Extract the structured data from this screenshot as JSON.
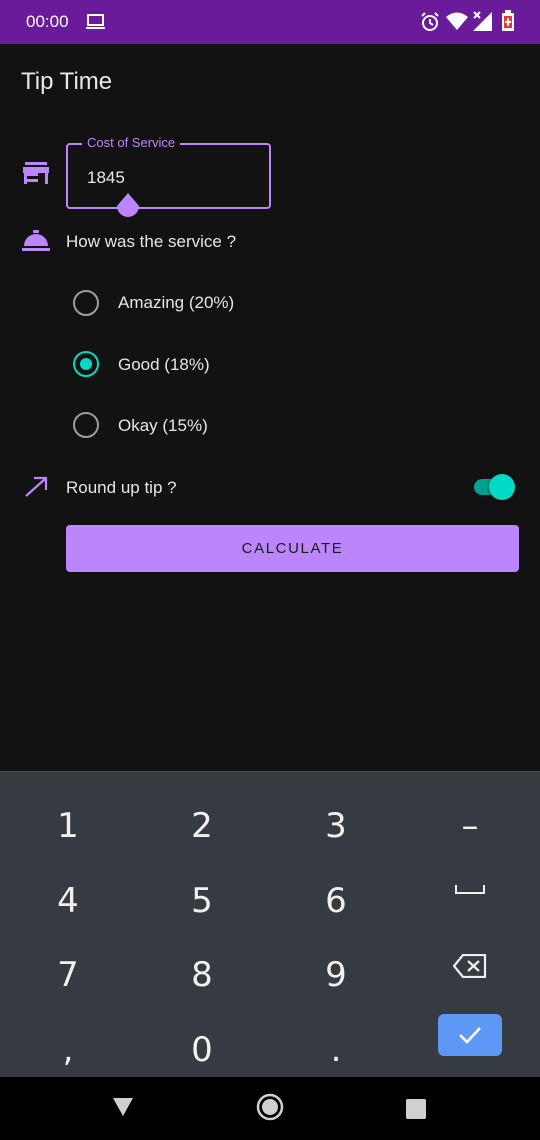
{
  "status_bar": {
    "time": "00:00",
    "icons": [
      "screen-cast-icon",
      "alarm-icon",
      "wifi-icon",
      "signal-icon",
      "battery-icon"
    ],
    "color": "#6a1b9a"
  },
  "app": {
    "title": "Tip Time",
    "accent": "#bb86fc",
    "secondary": "#03dac5",
    "background": "#121212"
  },
  "cost_field": {
    "label": "Cost of Service",
    "value": "1845",
    "icon": "store-icon"
  },
  "service": {
    "question": "How was the service ?",
    "icon": "room-service-icon",
    "options": [
      {
        "label": "Amazing (20%)",
        "checked": false
      },
      {
        "label": "Good (18%)",
        "checked": true
      },
      {
        "label": "Okay (15%)",
        "checked": false
      }
    ]
  },
  "round_up": {
    "label": "Round up tip ?",
    "icon": "trending-up-icon",
    "on": true
  },
  "calculate": {
    "label": "CALCULATE"
  },
  "keyboard": {
    "keys": [
      "1",
      "2",
      "3",
      "–",
      "4",
      "5",
      "6",
      "␣",
      "7",
      "8",
      "9",
      "⌫",
      ",",
      "0",
      ".",
      "✓"
    ],
    "enter_color": "#5e97f6"
  },
  "nav_bar": {
    "icons": [
      "back-icon",
      "home-icon",
      "recents-icon"
    ]
  }
}
